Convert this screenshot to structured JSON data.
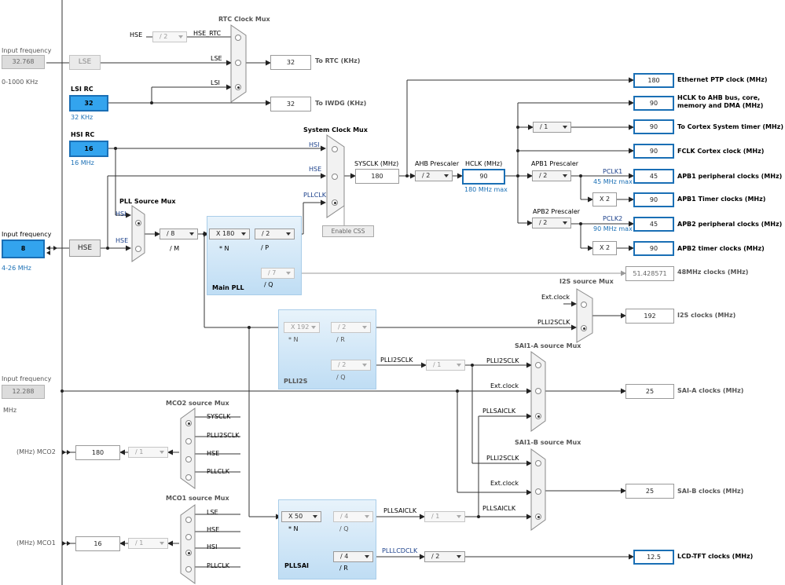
{
  "inputs": {
    "lse": {
      "label": "Input frequency",
      "value": "32.768",
      "range": "0-1000 KHz",
      "name": "LSE"
    },
    "lsi": {
      "name": "LSI RC",
      "value": "32",
      "sub": "32 KHz"
    },
    "hsi": {
      "name": "HSI RC",
      "value": "16",
      "sub": "16 MHz"
    },
    "hse": {
      "label": "Input frequency",
      "value": "8",
      "range": "4-26 MHz",
      "name": "HSE"
    },
    "ext": {
      "label": "Input frequency",
      "value": "12.288",
      "unit": "MHz"
    }
  },
  "rtc_mux": {
    "title": "RTC Clock Mux",
    "hse_label": "HSE",
    "hse_div": "/ 2",
    "hse_rtc": "HSE_RTC",
    "lse": "LSE",
    "lsi": "LSI",
    "rtc_value": "32",
    "rtc_out": "To RTC (KHz)",
    "iwdg_value": "32",
    "iwdg_out": "To IWDG (KHz)"
  },
  "sys_mux": {
    "title": "System Clock Mux",
    "hsi": "HSI",
    "hse": "HSE",
    "pllclk": "PLLCLK",
    "enable_css": "Enable CSS"
  },
  "pll_src": {
    "title": "PLL Source Mux",
    "hsi": "HSI",
    "hse": "HSE",
    "m_div": "/ 8",
    "m_label": "/ M"
  },
  "main_pll": {
    "title": "Main PLL",
    "n_mul": "X 180",
    "n_label": "* N",
    "p_div": "/ 2",
    "p_label": "/ P",
    "q_div": "/ 7",
    "q_label": "/ Q"
  },
  "sysclk": {
    "label": "SYSCLK (MHz)",
    "value": "180"
  },
  "ahb": {
    "label": "AHB Prescaler",
    "value": "/ 2"
  },
  "hclk": {
    "label": "HCLK (MHz)",
    "value": "90",
    "max": "180 MHz max"
  },
  "apb1": {
    "label": "APB1 Prescaler",
    "value": "/ 2",
    "pclk": "PCLK1",
    "max": "45 MHz max",
    "x2": "X 2"
  },
  "apb2": {
    "label": "APB2 Prescaler",
    "value": "/ 2",
    "pclk": "PCLK2",
    "max": "90 MHz max",
    "x2": "X 2"
  },
  "cortex_div": "/ 1",
  "outputs": [
    {
      "value": "180",
      "label": "Ethernet PTP clock (MHz)"
    },
    {
      "value": "90",
      "label": "HCLK to AHB bus, core,",
      "label2": "memory and DMA (MHz)"
    },
    {
      "value": "90",
      "label": "To Cortex System timer (MHz)"
    },
    {
      "value": "90",
      "label": "FCLK Cortex clock (MHz)"
    },
    {
      "value": "45",
      "label": "APB1 peripheral clocks (MHz)"
    },
    {
      "value": "90",
      "label": "APB1 Timer clocks (MHz)"
    },
    {
      "value": "45",
      "label": "APB2 peripheral clocks (MHz)"
    },
    {
      "value": "90",
      "label": "APB2 timer clocks (MHz)"
    },
    {
      "value": "51.428571",
      "label": "48MHz clocks (MHz)"
    },
    {
      "value": "192",
      "label": "I2S clocks (MHz)"
    },
    {
      "value": "25",
      "label": "SAI-A clocks (MHz)"
    },
    {
      "value": "25",
      "label": "SAI-B clocks (MHz)"
    },
    {
      "value": "12.5",
      "label": "LCD-TFT clocks (MHz)"
    }
  ],
  "i2s_mux": {
    "title": "I2S source Mux",
    "ext": "Ext.clock",
    "plli2s": "PLLI2SCLK"
  },
  "plli2s": {
    "title": "PLLI2S",
    "n_mul": "X 192",
    "n_label": "* N",
    "r_div": "/ 2",
    "r_label": "/ R",
    "q_div": "/ 2",
    "q_label": "/ Q",
    "out": "PLLI2SCLK",
    "div2": "/ 1"
  },
  "sai_a": {
    "title": "SAI1-A source Mux",
    "plli2s": "PLLI2SCLK",
    "ext": "Ext.clock",
    "pllsai": "PLLSAICLK"
  },
  "sai_b": {
    "title": "SAI1-B source Mux",
    "plli2s": "PLLI2SCLK",
    "ext": "Ext.clock",
    "pllsai": "PLLSAICLK"
  },
  "pllsai": {
    "title": "PLLSAI",
    "n_mul": "X 50",
    "n_label": "* N",
    "q_div": "/ 4",
    "q_label": "/ Q",
    "r_div": "/ 4",
    "r_label": "/ R",
    "q_out": "PLLSAICLK",
    "q_div2": "/ 1",
    "r_out": "PLLLCDCLK",
    "r_div2": "/ 2"
  },
  "mco2": {
    "title": "MCO2 source Mux",
    "inputs": [
      "SYSCLK",
      "PLLI2SCLK",
      "HSE",
      "PLLCLK"
    ],
    "div": "/ 1",
    "value": "180",
    "out": "(MHz) MCO2"
  },
  "mco1": {
    "title": "MCO1 source Mux",
    "inputs": [
      "LSE",
      "HSE",
      "HSI",
      "PLLCLK"
    ],
    "div": "/ 1",
    "value": "16",
    "out": "(MHz) MCO1"
  }
}
